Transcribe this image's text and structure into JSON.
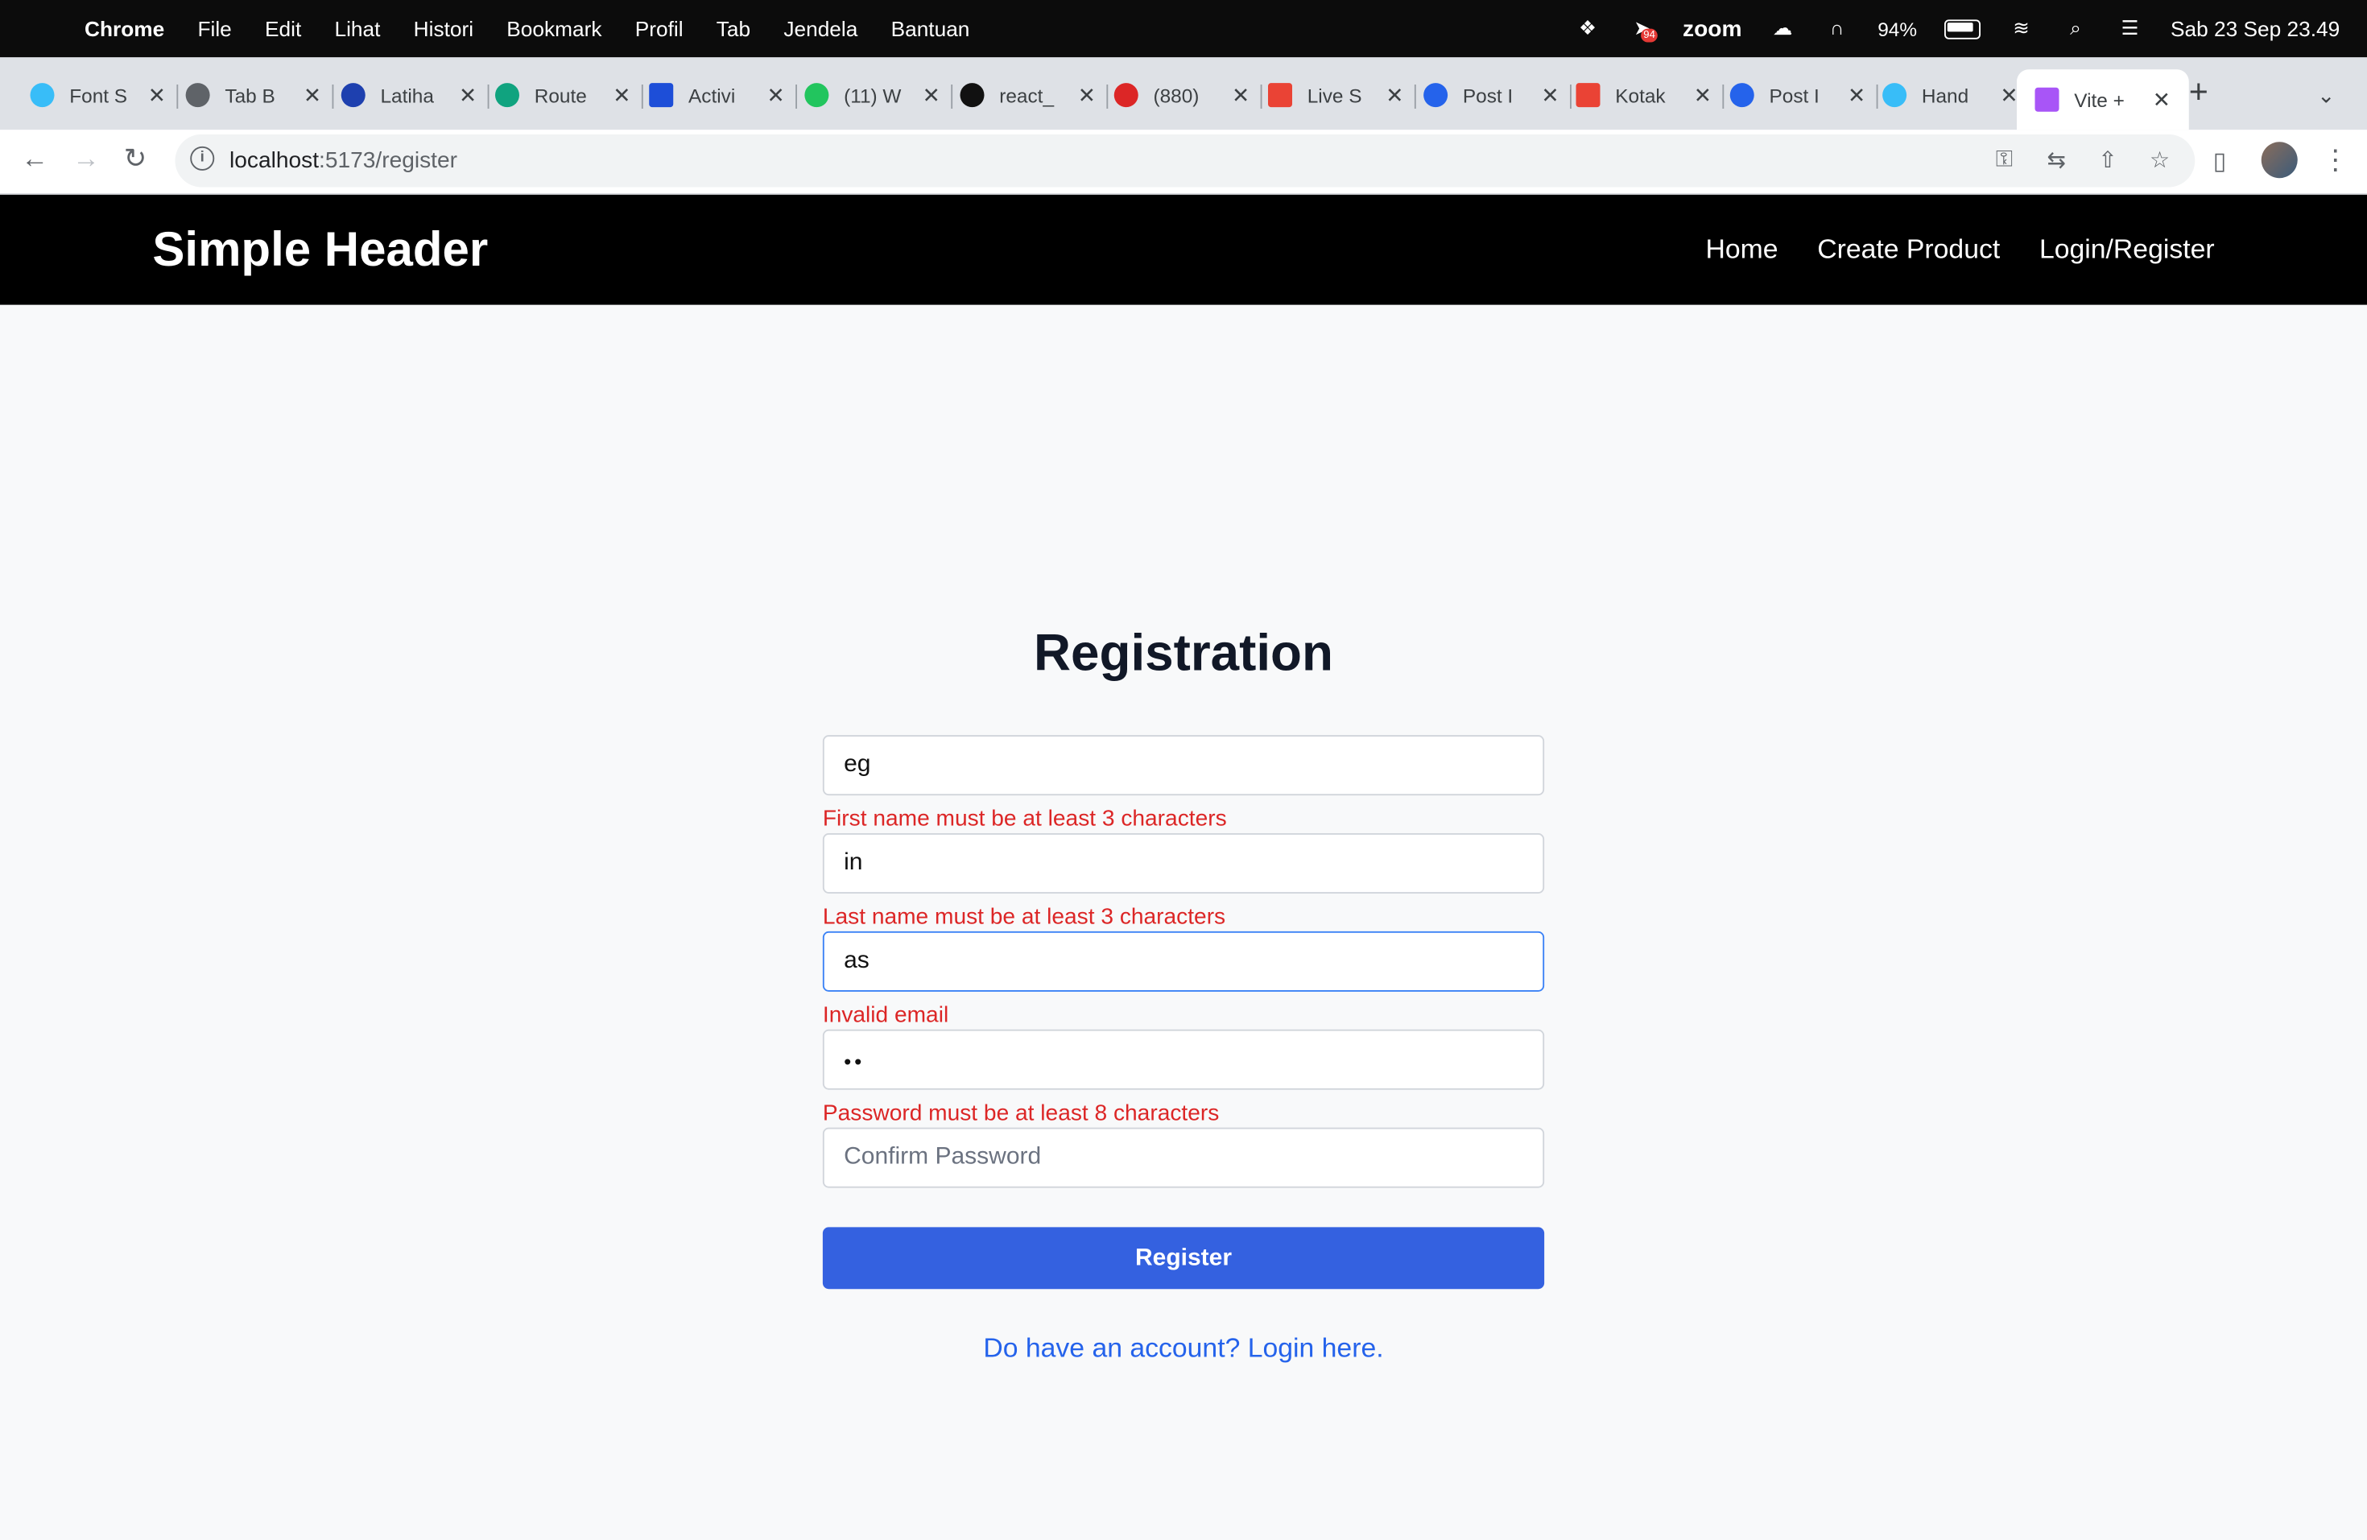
{
  "menubar": {
    "app": "Chrome",
    "items": [
      "File",
      "Edit",
      "Lihat",
      "Histori",
      "Bookmark",
      "Profil",
      "Tab",
      "Jendela",
      "Bantuan"
    ],
    "zoom_label": "zoom",
    "badge": "94",
    "battery": "94%",
    "clock": "Sab 23 Sep  23.49"
  },
  "tabs": [
    {
      "label": "Font S",
      "color": "#38bdf8"
    },
    {
      "label": "Tab B",
      "color": "#5f6368"
    },
    {
      "label": "Latiha",
      "color": "#1e40af"
    },
    {
      "label": "Route",
      "color": "#10a37f"
    },
    {
      "label": "Activi",
      "color": "#1d4ed8"
    },
    {
      "label": "(11) W",
      "color": "#22c55e"
    },
    {
      "label": "react_",
      "color": "#111111"
    },
    {
      "label": "(880)",
      "color": "#dc2626"
    },
    {
      "label": "Live S",
      "color": "#ea4335"
    },
    {
      "label": "Post I",
      "color": "#2563eb"
    },
    {
      "label": "Kotak",
      "color": "#ea4335"
    },
    {
      "label": "Post I",
      "color": "#2563eb"
    },
    {
      "label": "Hand",
      "color": "#38bdf8"
    },
    {
      "label": "Vite +",
      "color": "#a855f7"
    }
  ],
  "address": {
    "host": "localhost",
    "path": ":5173/register"
  },
  "site": {
    "brand": "Simple Header",
    "nav": [
      "Home",
      "Create Product",
      "Login/Register"
    ]
  },
  "form": {
    "title": "Registration",
    "first_name": "eg",
    "first_name_error": "First name must be at least 3 characters",
    "last_name": "in",
    "last_name_error": "Last name must be at least 3 characters",
    "email": "as",
    "email_error": "Invalid email",
    "password": "••",
    "password_error": "Password must be at least 8 characters",
    "confirm_placeholder": "Confirm Password",
    "submit": "Register",
    "login_link": "Do have an account? Login here."
  }
}
